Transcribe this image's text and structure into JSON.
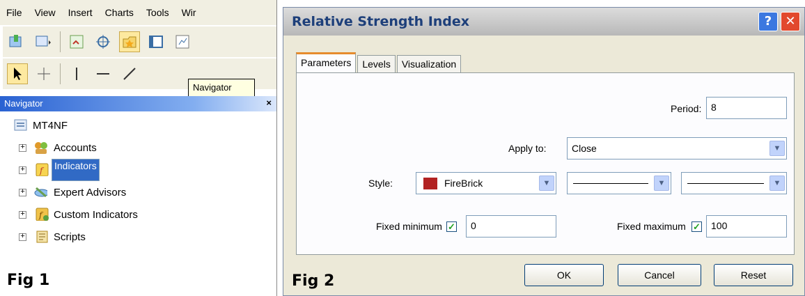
{
  "menu": [
    "File",
    "View",
    "Insert",
    "Charts",
    "Tools",
    "Wir"
  ],
  "tooltip": "Navigator",
  "navigator": {
    "title": "Navigator",
    "close": "×",
    "root": "MT4NF",
    "items": [
      {
        "label": "Accounts",
        "icon": "accounts-icon",
        "color": "#e09a2a"
      },
      {
        "label": "Indicators",
        "icon": "indicators-icon",
        "color": "#f2c940",
        "selected": true
      },
      {
        "label": "Expert Advisors",
        "icon": "expert-advisors-icon",
        "color": "#4a8fd8"
      },
      {
        "label": "Custom Indicators",
        "icon": "custom-indicators-icon",
        "color": "#e8b93c"
      },
      {
        "label": "Scripts",
        "icon": "scripts-icon",
        "color": "#d9b85a"
      }
    ]
  },
  "fig1": "Fig 1",
  "dialog": {
    "title": "Relative Strength Index",
    "help": "?",
    "close": "✕",
    "tabs": [
      "Parameters",
      "Levels",
      "Visualization"
    ],
    "period_label": "Period:",
    "period_value": "8",
    "apply_label": "Apply to:",
    "apply_value": "Close",
    "style_label": "Style:",
    "style_color_name": "FireBrick",
    "style_color": "#b22222",
    "fixed_min_label": "Fixed minimum",
    "fixed_min_value": "0",
    "fixed_max_label": "Fixed maximum",
    "fixed_max_value": "100",
    "ok": "OK",
    "cancel": "Cancel",
    "reset": "Reset"
  },
  "fig2": "Fig 2"
}
